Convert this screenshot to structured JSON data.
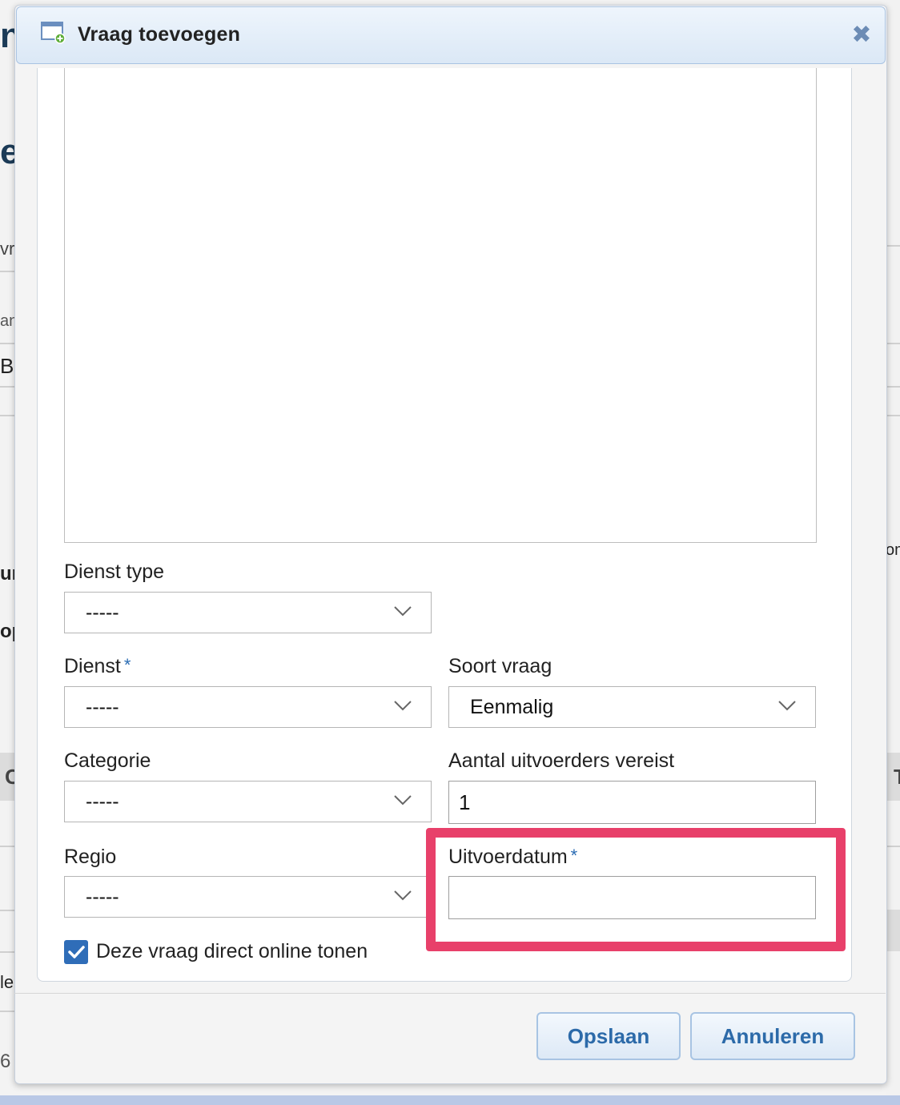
{
  "background": {
    "fragments": [
      "n",
      "e",
      "vr",
      "an",
      "Be",
      "ur",
      "op",
      "C",
      "le",
      "6",
      "om",
      "T"
    ]
  },
  "dialog": {
    "title": "Vraag toevoegen",
    "close_symbol": "✖",
    "fields": {
      "dienst_type": {
        "label": "Dienst type",
        "value": "-----"
      },
      "dienst": {
        "label": "Dienst",
        "required_mark": "*",
        "value": "-----"
      },
      "soort_vraag": {
        "label": "Soort vraag",
        "value": "Eenmalig"
      },
      "categorie": {
        "label": "Categorie",
        "value": "-----"
      },
      "aantal": {
        "label": "Aantal uitvoerders vereist",
        "value": "1"
      },
      "regio": {
        "label": "Regio",
        "value": "-----"
      },
      "uitvoerdatum": {
        "label": "Uitvoerdatum",
        "required_mark": "*",
        "value": ""
      }
    },
    "online_checkbox": {
      "label": "Deze vraag direct online tonen",
      "checked": true
    },
    "buttons": {
      "save": "Opslaan",
      "cancel": "Annuleren"
    }
  },
  "colors": {
    "accent": "#2f6db8",
    "highlight": "#e8406a",
    "button_text": "#2c6aa9"
  }
}
